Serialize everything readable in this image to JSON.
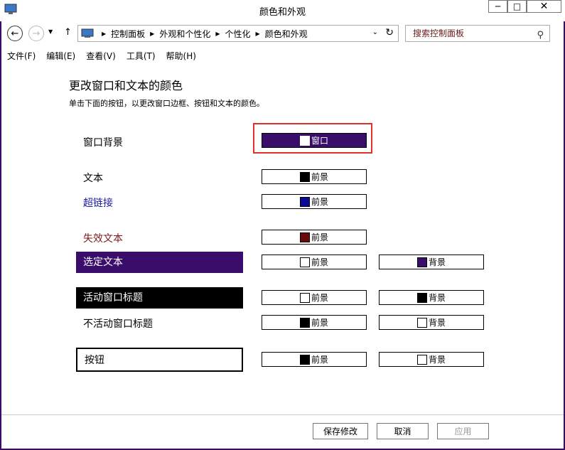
{
  "window": {
    "title": "颜色和外观"
  },
  "address_bar": {
    "crumbs": [
      "控制面板",
      "外观和个性化",
      "个性化",
      "颜色和外观"
    ]
  },
  "search": {
    "placeholder": "搜索控制面板"
  },
  "menu": [
    "文件(F)",
    "编辑(E)",
    "查看(V)",
    "工具(T)",
    "帮助(H)"
  ],
  "main": {
    "heading": "更改窗口和文本的颜色",
    "description": "单击下面的按钮，以更改窗口边框、按钮和文本的颜色。"
  },
  "rows": {
    "window_bg": {
      "label": "窗口背景",
      "btn": "窗口",
      "swatch": "#ffffff",
      "button_bg": "#3a0d6b",
      "button_fg": "#ffffff"
    },
    "text": {
      "label": "文本",
      "btn": "前景",
      "swatch": "#000000"
    },
    "hyperlink": {
      "label": "超链接",
      "btn": "前景",
      "swatch": "#0a0a99",
      "label_color": "#1a1aa0"
    },
    "disabled": {
      "label": "失效文本",
      "btn": "前景",
      "swatch": "#6b0a0a",
      "label_color": "#7a1a1a"
    },
    "selected": {
      "label": "选定文本",
      "fg_btn": "前景",
      "fg_swatch": "#ffffff",
      "bg_btn": "背景",
      "bg_swatch": "#3a0d6b",
      "label_bg": "#3a0d6b",
      "label_fg": "#ffffff"
    },
    "active_title": {
      "label": "活动窗口标题",
      "fg_btn": "前景",
      "fg_swatch": "#ffffff",
      "bg_btn": "背景",
      "bg_swatch": "#000000",
      "label_bg": "#000000",
      "label_fg": "#ffffff"
    },
    "inactive_title": {
      "label": "不活动窗口标题",
      "fg_btn": "前景",
      "fg_swatch": "#000000",
      "bg_btn": "背景",
      "bg_swatch": "#ffffff"
    },
    "button": {
      "label": "按钮",
      "fg_btn": "前景",
      "fg_swatch": "#000000",
      "bg_btn": "背景",
      "bg_swatch": "#ffffff"
    }
  },
  "footer": {
    "save": "保存修改",
    "cancel": "取消",
    "apply": "应用"
  },
  "colors": {
    "accent": "#3a0d6b",
    "highlight_box": "#e03030"
  }
}
